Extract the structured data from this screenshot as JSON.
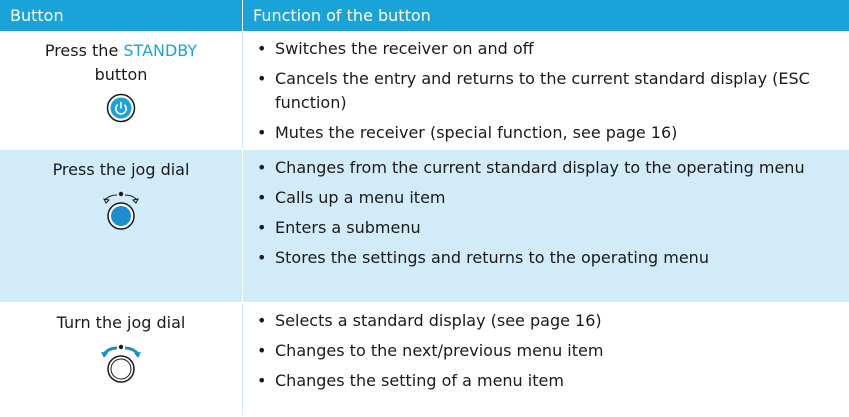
{
  "header": {
    "col1": "Button",
    "col2": "Function of the button"
  },
  "rows": [
    {
      "label_prefix": "Press the ",
      "label_accent": "STANDBY",
      "label_suffix": "button",
      "icon": "standby-power-icon",
      "functions": [
        "Switches the receiver on and off",
        "Cancels the entry and returns to the current standard display (ESC function)",
        "Mutes the receiver (special function, see page 16)"
      ]
    },
    {
      "label": "Press the jog dial",
      "icon": "jog-dial-press-icon",
      "functions": [
        "Changes from the current standard display to the operating menu",
        "Calls up a menu item",
        "Enters a submenu",
        "Stores the settings and returns to the operating menu"
      ]
    },
    {
      "label": "Turn the jog dial",
      "icon": "jog-dial-turn-icon",
      "functions": [
        "Selects a standard display (see page 16)",
        "Changes to the next/previous menu item",
        "Changes the setting of a menu item"
      ]
    }
  ],
  "colors": {
    "header_bg": "#1aa3d9",
    "accent": "#1aa3d9",
    "row_highlight": "#d1ebf8"
  }
}
